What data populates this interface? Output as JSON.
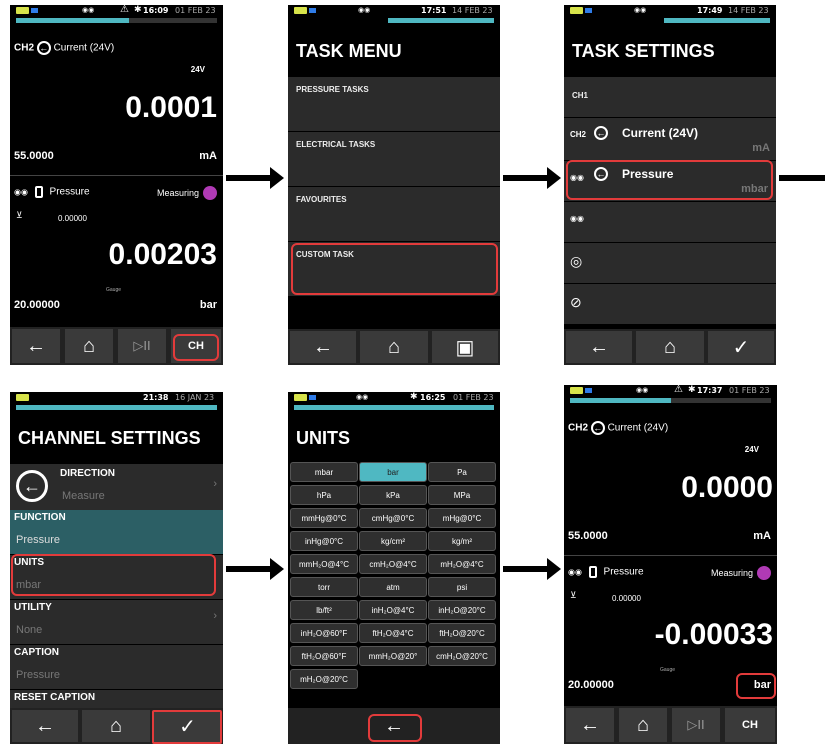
{
  "screen1": {
    "time": "16:09",
    "date": "01 FEB 23",
    "progress": 0.56,
    "ch2_label": "CH2",
    "ch2_name": "Current (24V)",
    "range": "24V",
    "reading1": "0.0001",
    "sub1_left": "55.0000",
    "sub1_unit": "mA",
    "p_channel_name": "Pressure",
    "p_mode": "Measuring",
    "zero_val": "0.00000",
    "reading2": "0.00203",
    "sub2_left": "20.00000",
    "gauge": "Gauge",
    "sub2_unit": "bar",
    "nav": {
      "back": "←",
      "home": "⌂",
      "play": "▷II",
      "ch": "CH"
    }
  },
  "screen2": {
    "time": "17:51",
    "date": "14 FEB 23",
    "title": "TASK MENU",
    "items": [
      "PRESSURE TASKS",
      "ELECTRICAL TASKS",
      "FAVOURITES",
      "CUSTOM TASK"
    ],
    "nav": {
      "back": "←",
      "home": "⌂",
      "save": "▣"
    }
  },
  "screen3": {
    "time": "17:49",
    "date": "14 FEB 23",
    "title": "TASK SETTINGS",
    "ch1": "CH1",
    "ch2": "CH2",
    "ch2_name": "Current (24V)",
    "ch2_unit": "mA",
    "p1_name": "Pressure",
    "p1_unit": "mbar",
    "nav": {
      "back": "←",
      "home": "⌂",
      "ok": "✓"
    }
  },
  "screen4": {
    "time": "21:38",
    "date": "16 JAN 23",
    "title": "CHANNEL SETTINGS",
    "direction_label": "DIRECTION",
    "direction_value": "Measure",
    "function_label": "FUNCTION",
    "function_value": "Pressure",
    "units_label": "UNITS",
    "units_value": "mbar",
    "utility_label": "UTILITY",
    "utility_value": "None",
    "caption_label": "CAPTION",
    "caption_value": "Pressure",
    "reset_label": "RESET CAPTION",
    "nav": {
      "back": "←",
      "home": "⌂",
      "ok": "✓"
    }
  },
  "screen5": {
    "time": "16:25",
    "date": "01 FEB 23",
    "title": "UNITS",
    "units": [
      [
        "mbar",
        "bar",
        "Pa"
      ],
      [
        "hPa",
        "kPa",
        "MPa"
      ],
      [
        "mmHg@0°C",
        "cmHg@0°C",
        "mHg@0°C"
      ],
      [
        "inHg@0°C",
        "kg/cm²",
        "kg/m²"
      ],
      [
        "mmH₂O@4°C",
        "cmH₂O@4°C",
        "mH₂O@4°C"
      ],
      [
        "torr",
        "atm",
        "psi"
      ],
      [
        "lb/ft²",
        "inH₂O@4°C",
        "inH₂O@20°C"
      ],
      [
        "inH₂O@60°F",
        "ftH₂O@4°C",
        "ftH₂O@20°C"
      ],
      [
        "ftH₂O@60°F",
        "mmH₂O@20°",
        "cmH₂O@20°C"
      ],
      [
        "mH₂O@20°C"
      ]
    ],
    "selected": "bar",
    "nav": {
      "back": "←"
    }
  },
  "screen6": {
    "time": "17:37",
    "date": "01 FEB 23",
    "progress": 0.5,
    "ch2_label": "CH2",
    "ch2_name": "Current (24V)",
    "range": "24V",
    "reading1": "0.0000",
    "sub1_left": "55.0000",
    "sub1_unit": "mA",
    "p_channel_name": "Pressure",
    "p_mode": "Measuring",
    "zero_val": "0.00000",
    "reading2": "-0.00033",
    "sub2_left": "20.00000",
    "gauge": "Gauge",
    "sub2_unit": "bar",
    "nav": {
      "back": "←",
      "home": "⌂",
      "play": "▷II",
      "ch": "CH"
    }
  },
  "colors": {
    "accent": "#4fb8c2",
    "highlight": "#e23b3b",
    "battery": "#d7e34a",
    "purple": "#b03ab5"
  }
}
